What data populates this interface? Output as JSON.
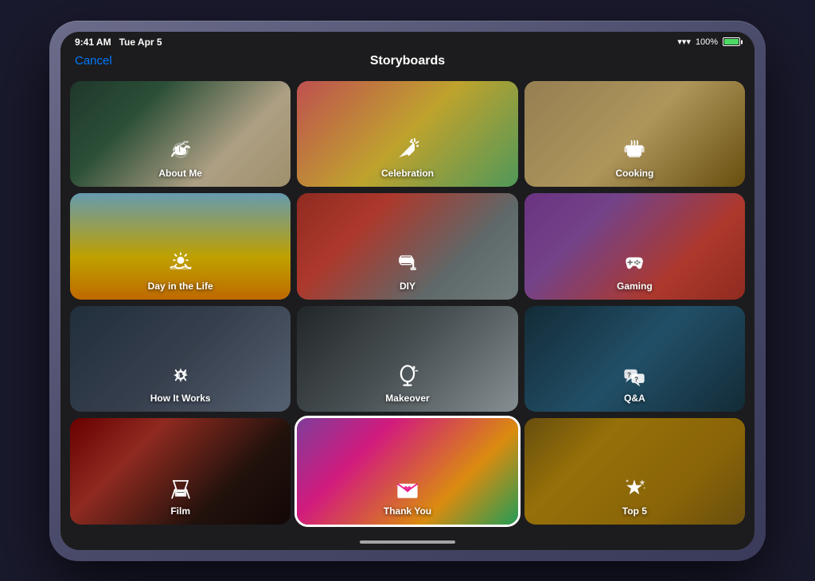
{
  "device": {
    "status_bar": {
      "time": "9:41 AM",
      "date": "Tue Apr 5",
      "wifi": "100%",
      "battery_label": "100%"
    },
    "nav": {
      "cancel_label": "Cancel",
      "title": "Storyboards"
    }
  },
  "grid": {
    "items": [
      {
        "id": "about-me",
        "label": "About Me",
        "bg_class": "bg-about-me",
        "icon": "wave",
        "selected": false
      },
      {
        "id": "celebration",
        "label": "Celebration",
        "bg_class": "bg-celebration",
        "icon": "party",
        "selected": false
      },
      {
        "id": "cooking",
        "label": "Cooking",
        "bg_class": "bg-cooking",
        "icon": "pot",
        "selected": false
      },
      {
        "id": "day-in-life",
        "label": "Day in the Life",
        "bg_class": "bg-day-in-life",
        "icon": "sun",
        "selected": false
      },
      {
        "id": "diy",
        "label": "DIY",
        "bg_class": "bg-diy",
        "icon": "roller",
        "selected": false
      },
      {
        "id": "gaming",
        "label": "Gaming",
        "bg_class": "bg-gaming",
        "icon": "gamepad",
        "selected": false
      },
      {
        "id": "how-it-works",
        "label": "How It Works",
        "bg_class": "bg-how-it-works",
        "icon": "settings",
        "selected": false
      },
      {
        "id": "makeover",
        "label": "Makeover",
        "bg_class": "bg-makeover",
        "icon": "mirror",
        "selected": false
      },
      {
        "id": "qa",
        "label": "Q&A",
        "bg_class": "bg-qa",
        "icon": "speech",
        "selected": false
      },
      {
        "id": "film",
        "label": "Film",
        "bg_class": "bg-film",
        "icon": "director",
        "selected": false
      },
      {
        "id": "thank-you",
        "label": "Thank You",
        "bg_class": "bg-thank-you",
        "icon": "envelope",
        "selected": true
      },
      {
        "id": "top5",
        "label": "Top 5",
        "bg_class": "bg-top5",
        "icon": "star",
        "selected": false
      }
    ]
  }
}
